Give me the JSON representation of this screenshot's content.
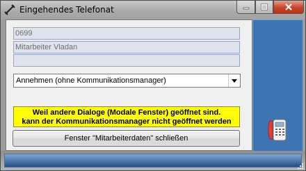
{
  "window": {
    "title": "Eingehendes Telefonat"
  },
  "fields": {
    "caller_number": "0699",
    "caller_name": "Mitarbeiter Vladan",
    "extra_info": ""
  },
  "action_select": {
    "value": "Annehmen (ohne Kommunikationsmanager)"
  },
  "warning": {
    "line1": "Weil andere Dialoge (Modale Fenster) geöffnet sind.",
    "line2": "kann der Kommunikationsmanager nicht geöffnet werden"
  },
  "buttons": {
    "close_employee_data": "Fenster \"Mitarbeiterdaten\" schließen"
  },
  "icons": {
    "title": "phone-handset-icon",
    "side": "desk-phone-icon"
  },
  "colors": {
    "warning_bg": "#ffff00",
    "side_panel": "#3d74b2",
    "close_button": "#c8432b"
  }
}
